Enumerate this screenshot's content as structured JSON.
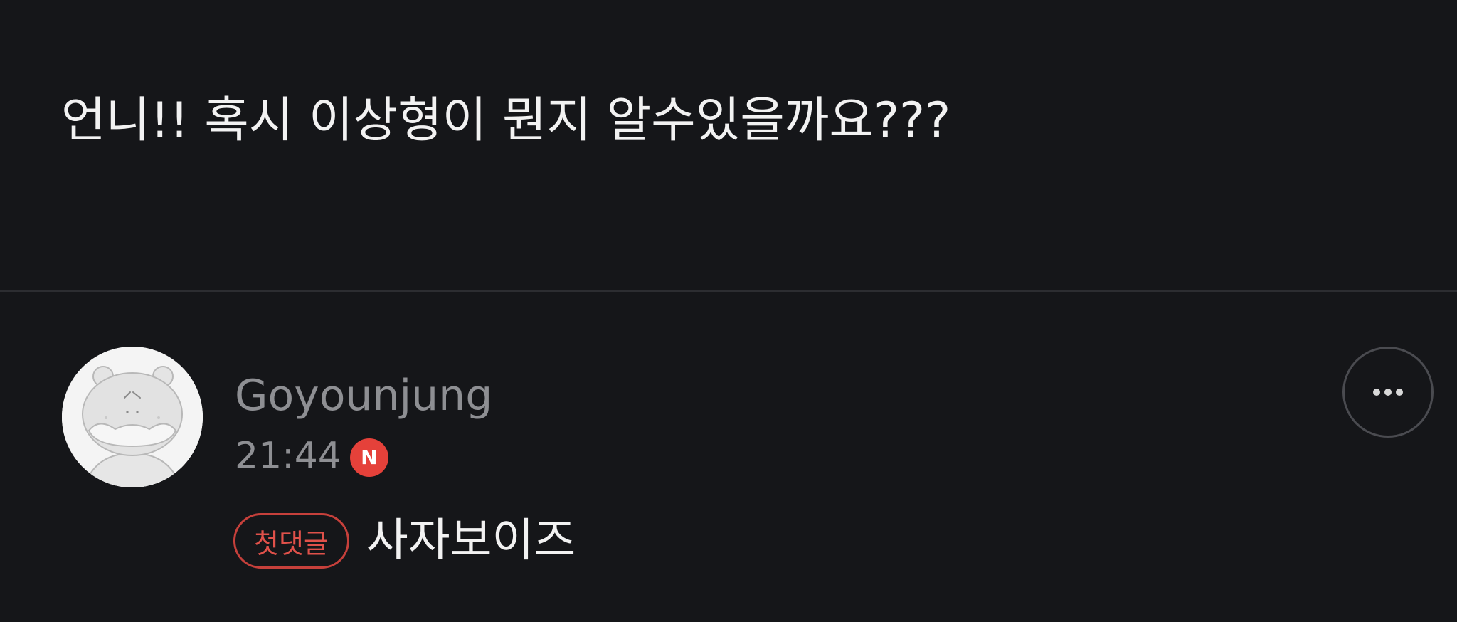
{
  "post": {
    "body": "언니!! 혹시 이상형이 뭔지 알수있을까요???"
  },
  "comment": {
    "author": "Goyounjung",
    "time": "21:44",
    "new_badge": "N",
    "first_comment_tag": "첫댓글",
    "text": "사자보이즈",
    "avatar_icon": "cartoon-bear-avatar",
    "more_icon": "more-horizontal-icon"
  },
  "colors": {
    "background": "#151619",
    "accent_red": "#e5413a",
    "muted_text": "#8e8f93"
  }
}
